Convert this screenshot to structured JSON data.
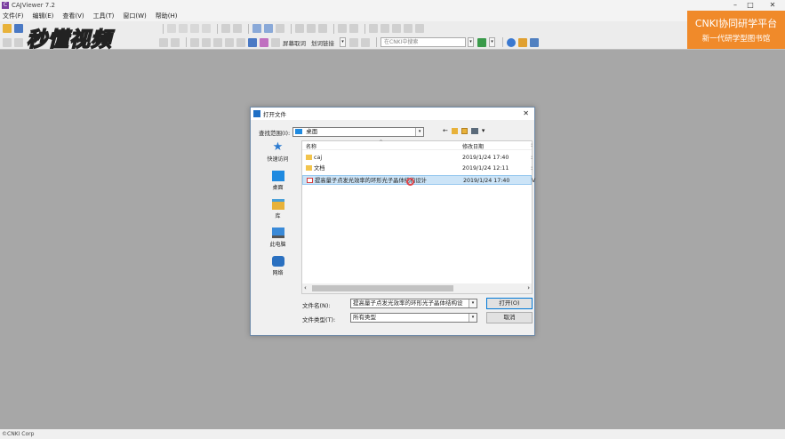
{
  "window": {
    "title": "CAJViewer 7.2",
    "min": "–",
    "max": "□",
    "close": "✕"
  },
  "menu": [
    "文件(F)",
    "编辑(E)",
    "查看(V)",
    "工具(T)",
    "窗口(W)",
    "帮助(H)"
  ],
  "toolbar2": {
    "full_screen": "屏幕取词",
    "link": "划词链接",
    "cnki_search_placeholder": "在CNKI中搜索"
  },
  "watermark": "秒懂视频",
  "cnki_banner": {
    "line1": "CNKI协同研学平台",
    "line2": "新一代研学型图书馆"
  },
  "status": "©CNKI Corp",
  "dialog": {
    "title": "打开文件",
    "close": "✕",
    "lookin_label": "查找范围(I):",
    "lookin_value": "桌面",
    "places": [
      "快速访问",
      "桌面",
      "库",
      "此电脑",
      "网络"
    ],
    "columns": {
      "name": "名称",
      "date": "修改日期"
    },
    "files": [
      {
        "name": "caj",
        "date": "2019/1/24 17:40",
        "extra": ":",
        "type": "folder"
      },
      {
        "name": "文档",
        "date": "2019/1/24 12:11",
        "extra": ":",
        "type": "folder"
      },
      {
        "name": "提高量子点发光效率的环形光子晶体结构设计",
        "date": "2019/1/24 17:40",
        "extra": "V",
        "type": "pdf",
        "selected": true
      }
    ],
    "filename_label": "文件名(N):",
    "filename_value": "提高量子点发光效率的环形光子晶体结构设",
    "filetype_label": "文件类型(T):",
    "filetype_value": "所有类型",
    "open_btn": "打开(O)",
    "cancel_btn": "取消"
  },
  "colors": {
    "cnki_orange": "#f08a2a",
    "selection": "#cce4f7",
    "workspace": "#a7a7a7",
    "folder": "#f2c44d",
    "pdf": "#d63a3a"
  }
}
